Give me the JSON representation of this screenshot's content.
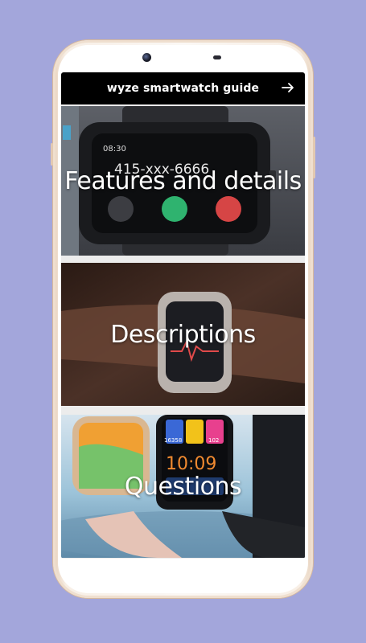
{
  "theme": {
    "background": "#a3a6db",
    "appbar": "#000000",
    "card1_bg": "#4b4e56",
    "card2_bg": "#3a2a22",
    "card3_bg": "#8fb7cc"
  },
  "appbar": {
    "title": "wyze smartwatch guide",
    "forward_icon": "arrow-right-icon"
  },
  "cards": [
    {
      "label": "Features and details",
      "watch_time": "08:30",
      "watch_number": "415-xxx-6666"
    },
    {
      "label": "Descriptions"
    },
    {
      "label": "Questions",
      "watch_time": "10:09",
      "watch_steps": "16358",
      "watch_bpm": "102"
    }
  ]
}
